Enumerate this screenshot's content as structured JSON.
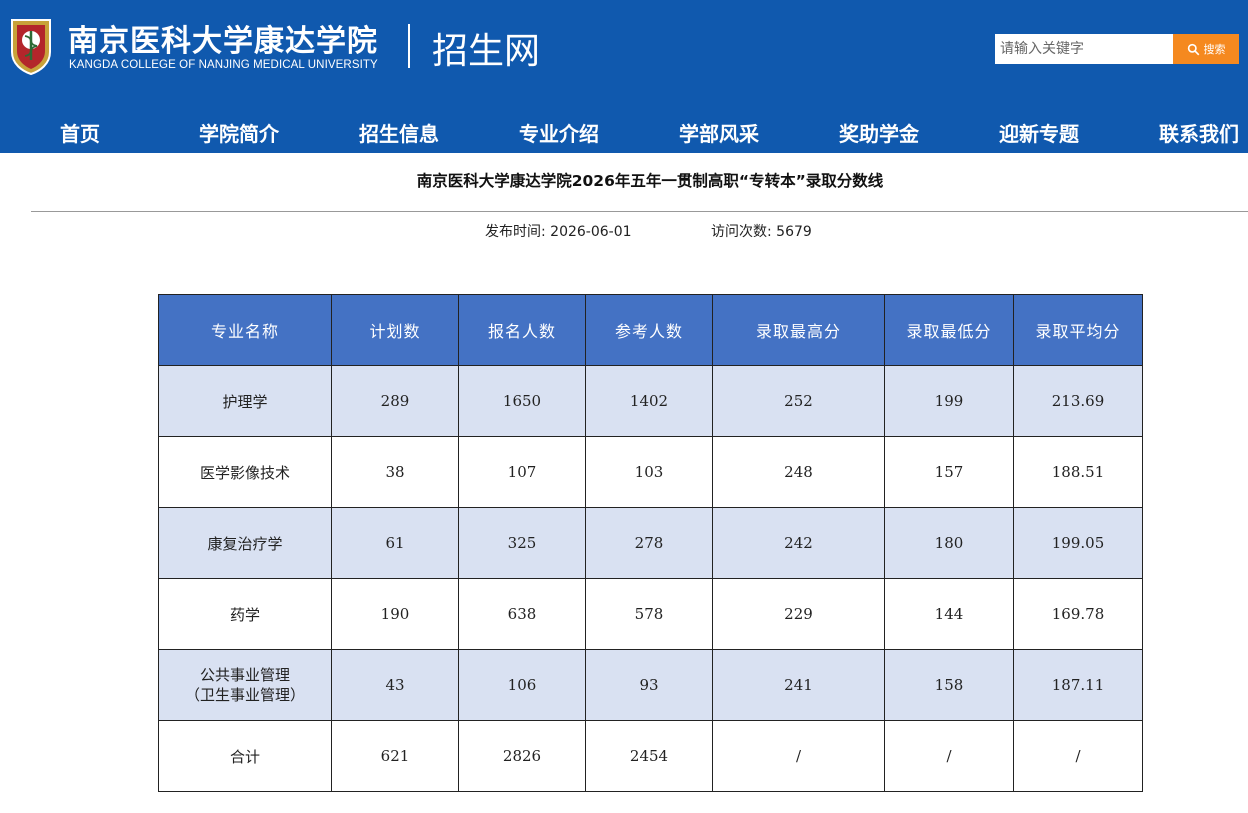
{
  "header": {
    "logo_cn": "南京医科大学康达学院",
    "logo_en": "KANGDA COLLEGE OF NANJING MEDICAL UNIVERSITY",
    "site_name": "招生网",
    "search_placeholder": "请输入关键字",
    "search_button": "搜索",
    "search_icon": "search-icon",
    "background_color": "#1059ae",
    "search_button_color": "#f5891f"
  },
  "nav": {
    "items": [
      "首页",
      "学院简介",
      "招生信息",
      "专业介绍",
      "学部风采",
      "奖助学金",
      "迎新专题",
      "联系我们"
    ]
  },
  "article": {
    "title": "南京医科大学康达学院2026年五年一贯制高职“专转本”录取分数线",
    "publish_label": "发布时间: 2026-06-01",
    "visits_label": "访问次数: 5679"
  },
  "table": {
    "header_color": "#4472c4",
    "stripe_color": "#d9e1f2",
    "columns": [
      "专业名称",
      "计划数",
      "报名人数",
      "参考人数",
      "录取最高分",
      "录取最低分",
      "录取平均分"
    ],
    "rows": [
      {
        "name": "护理学",
        "name_line2": "",
        "plan": "289",
        "applied": "1650",
        "took": "1402",
        "max": "252",
        "min": "199",
        "avg": "213.69"
      },
      {
        "name": "医学影像技术",
        "name_line2": "",
        "plan": "38",
        "applied": "107",
        "took": "103",
        "max": "248",
        "min": "157",
        "avg": "188.51"
      },
      {
        "name": "康复治疗学",
        "name_line2": "",
        "plan": "61",
        "applied": "325",
        "took": "278",
        "max": "242",
        "min": "180",
        "avg": "199.05"
      },
      {
        "name": "药学",
        "name_line2": "",
        "plan": "190",
        "applied": "638",
        "took": "578",
        "max": "229",
        "min": "144",
        "avg": "169.78"
      },
      {
        "name": "公共事业管理",
        "name_line2": "（卫生事业管理）",
        "plan": "43",
        "applied": "106",
        "took": "93",
        "max": "241",
        "min": "158",
        "avg": "187.11"
      },
      {
        "name": "合计",
        "name_line2": "",
        "plan": "621",
        "applied": "2826",
        "took": "2454",
        "max": "/",
        "min": "/",
        "avg": "/"
      }
    ]
  }
}
